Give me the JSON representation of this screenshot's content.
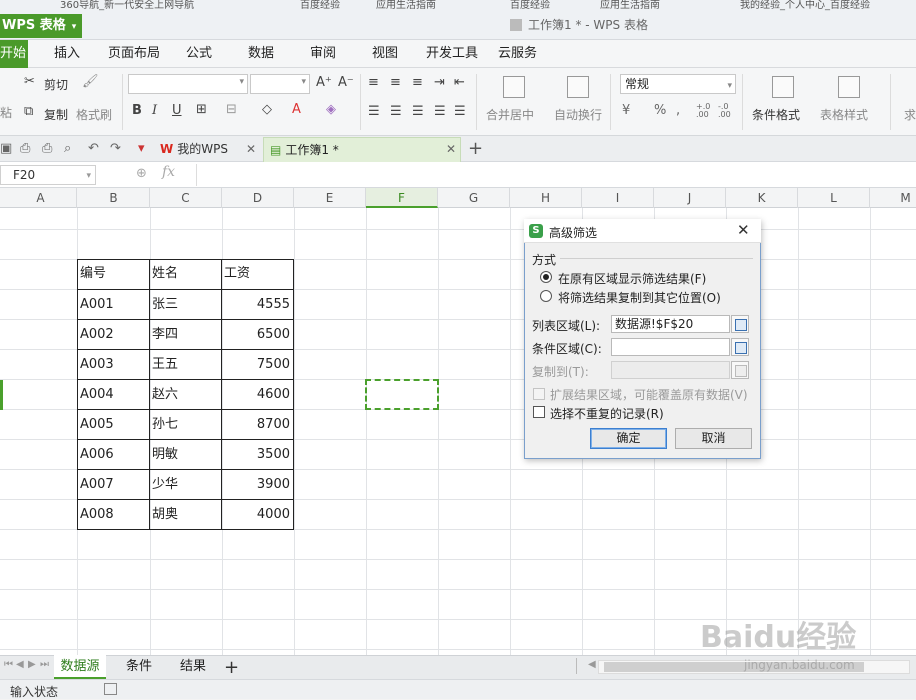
{
  "browser_tabs": [
    "360导航_新一代安全上网导航",
    "百度经验",
    "应用生活指南",
    "百度经验",
    "应用生活指南",
    "我的经验_个人中心_百度经验"
  ],
  "app_menu_label": "WPS 表格",
  "window_title": "工作簿1 * - WPS 表格",
  "ribbon_tabs": [
    "开始",
    "插入",
    "页面布局",
    "公式",
    "数据",
    "审阅",
    "视图",
    "开发工具",
    "云服务"
  ],
  "ribbon": {
    "paste_label": "粘贴",
    "cut_label": "剪切",
    "copy_label": "复制",
    "format_painter_label": "格式刷",
    "merge_label": "合并居中",
    "wrap_label": "自动换行",
    "number_format_value": "常规",
    "conditional_format_label": "条件格式",
    "table_style_label": "表格样式",
    "sum_label": "求和"
  },
  "doc_tabs": [
    {
      "label": "我的WPS"
    },
    {
      "label": "工作簿1 *"
    }
  ],
  "formula_bar": {
    "name_box": "F20",
    "fx": "fx",
    "content": ""
  },
  "columns": [
    "A",
    "B",
    "C",
    "D",
    "E",
    "F",
    "G",
    "H",
    "I",
    "J",
    "K",
    "L",
    "M"
  ],
  "selected_column": "F",
  "table": {
    "headers": [
      "编号",
      "姓名",
      "工资"
    ],
    "rows": [
      [
        "A001",
        "张三",
        "4555"
      ],
      [
        "A002",
        "李四",
        "6500"
      ],
      [
        "A003",
        "王五",
        "7500"
      ],
      [
        "A004",
        "赵六",
        "4600"
      ],
      [
        "A005",
        "孙七",
        "8700"
      ],
      [
        "A006",
        "明敏",
        "3500"
      ],
      [
        "A007",
        "少华",
        "3900"
      ],
      [
        "A008",
        "胡奥",
        "4000"
      ]
    ]
  },
  "dialog": {
    "title": "高级筛选",
    "logo": "S",
    "method_label": "方式",
    "radio_in_place": "在原有区域显示筛选结果(F)",
    "radio_copy": "将筛选结果复制到其它位置(O)",
    "list_range_label": "列表区域(L):",
    "list_range_value": "数据源!$F$20",
    "criteria_range_label": "条件区域(C):",
    "criteria_range_value": "",
    "copy_to_label": "复制到(T):",
    "copy_to_value": "",
    "extend_label": "扩展结果区域，可能覆盖原有数据(V)",
    "unique_label": "选择不重复的记录(R)",
    "ok_label": "确定",
    "cancel_label": "取消"
  },
  "sheets": [
    {
      "label": "数据源",
      "active": true
    },
    {
      "label": "条件",
      "active": false
    },
    {
      "label": "结果",
      "active": false
    }
  ],
  "status": {
    "text": "输入状态"
  },
  "watermark": {
    "main": "Baidu经验",
    "sub": "jingyan.baidu.com"
  },
  "colors": {
    "accent_green": "#4a9a2a",
    "dialog_border": "#7a9fcc"
  }
}
